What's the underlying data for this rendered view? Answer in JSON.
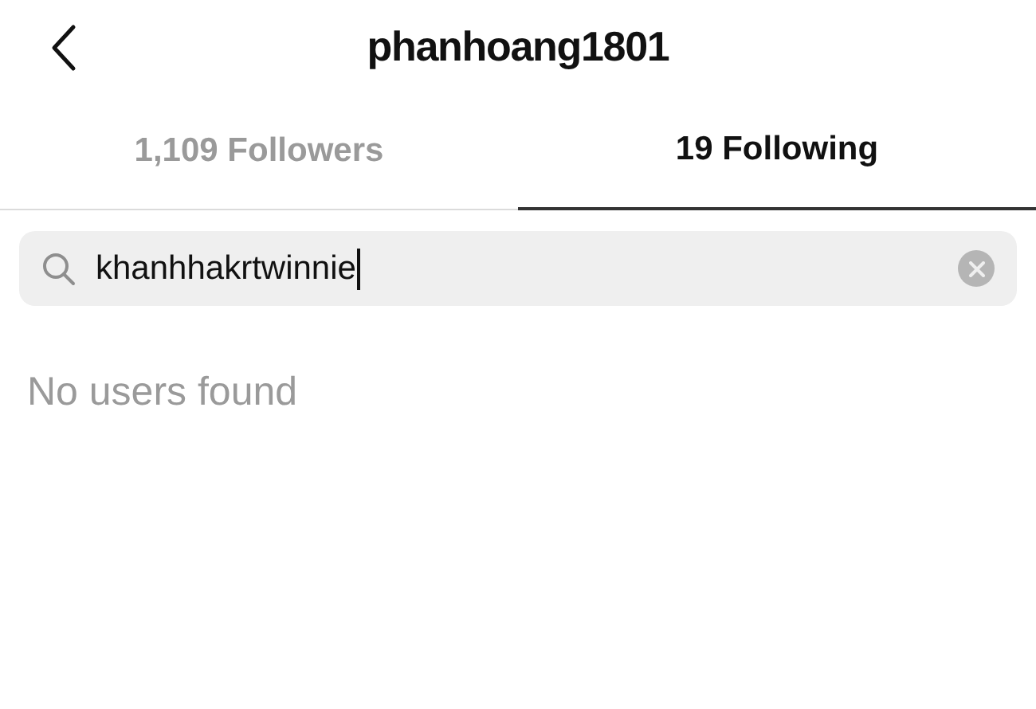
{
  "header": {
    "title": "phanhoang1801"
  },
  "tabs": [
    {
      "label": "1,109 Followers",
      "selected": false
    },
    {
      "label": "19 Following",
      "selected": true
    }
  ],
  "search": {
    "value": "khanhhakrtwinnie"
  },
  "empty_message": "No users found"
}
